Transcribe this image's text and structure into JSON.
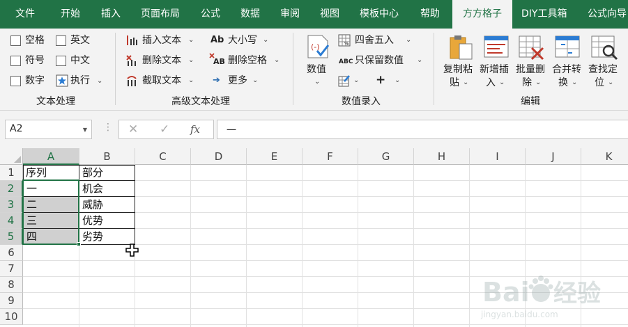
{
  "tabs": [
    "文件",
    "开始",
    "插入",
    "页面布局",
    "公式",
    "数据",
    "审阅",
    "视图",
    "模板中心",
    "帮助",
    "方方格子",
    "DIY工具箱",
    "公式向导"
  ],
  "active_tab": "方方格子",
  "ribbon": {
    "text_processing": {
      "label": "文本处理",
      "checks": [
        "空格",
        "英文",
        "符号",
        "中文",
        "数字"
      ],
      "execute": "执行"
    },
    "advanced_text": {
      "label": "高级文本处理",
      "insert_text": "插入文本",
      "delete_text": "删除文本",
      "truncate_text": "截取文本",
      "case": "大小写",
      "delete_spaces": "删除空格",
      "more": "更多",
      "case_icon_text": "Ab",
      "delete_spaces_icon_text": "AB"
    },
    "numeric_entry": {
      "label": "数值录入",
      "value": "数值",
      "round": "四舍五入",
      "keep_values": "只保留数值",
      "keep_values_icon_text": "ABC",
      "plus": "+"
    },
    "edit": {
      "label": "编辑",
      "copy_paste": [
        "复制粘",
        "贴"
      ],
      "new_insert": [
        "新增插",
        "入"
      ],
      "batch_delete": [
        "批量删",
        "除"
      ],
      "merge_convert": [
        "合并转",
        "换"
      ],
      "find_locate": [
        "查找定",
        "位"
      ]
    }
  },
  "formula_bar": {
    "name_box": "A2",
    "fx": "fx",
    "formula_value": "一"
  },
  "columns": [
    "A",
    "B",
    "C",
    "D",
    "E",
    "F",
    "G",
    "H",
    "I",
    "J",
    "K"
  ],
  "rows": [
    "1",
    "2",
    "3",
    "4",
    "5",
    "6",
    "7",
    "8",
    "9",
    "10"
  ],
  "cells": {
    "A1": "序列",
    "B1": "部分",
    "A2": "一",
    "B2": "机会",
    "A3": "二",
    "B3": "威胁",
    "A4": "三",
    "B4": "优势",
    "A5": "四",
    "B5": "劣势"
  },
  "selected_range": "A2:A5",
  "watermark": "Baidu经验 jingyan.baidu.com",
  "colors": {
    "ribbon_green": "#217346",
    "ribbon_bg": "#f3f3f3",
    "selection_shade": "#d0d0d0"
  }
}
